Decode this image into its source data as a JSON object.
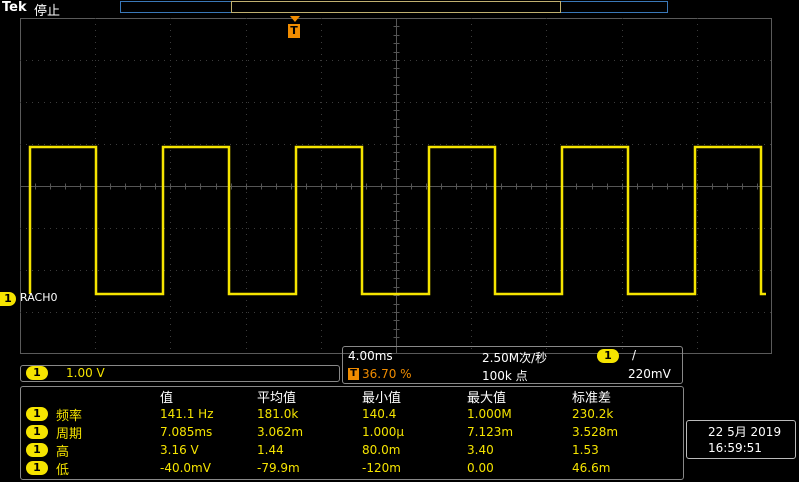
{
  "header": {
    "brand": "Tek",
    "status": "停止"
  },
  "trigger": {
    "marker": "T"
  },
  "channel": {
    "id": "1",
    "name": "RACH0",
    "scale": "1.00 V"
  },
  "timebase": {
    "horizontal_scale": "4.00ms",
    "sample_rate": "2.50M次/秒",
    "trigger_position": "36.70 %",
    "record_length": "100k 点",
    "trigger_channel": "1",
    "trigger_slope": "/",
    "trigger_level": "220mV"
  },
  "measurements": {
    "headers": [
      "值",
      "平均值",
      "最小值",
      "最大值",
      "标准差"
    ],
    "rows": [
      {
        "label": "频率",
        "value": "141.1 Hz",
        "mean": "181.0k",
        "min": "140.4",
        "max": "1.000M",
        "std": "230.2k"
      },
      {
        "label": "周期",
        "value": "7.085ms",
        "mean": "3.062m",
        "min": "1.000μ",
        "max": "7.123m",
        "std": "3.528m"
      },
      {
        "label": "高",
        "value": "3.16 V",
        "mean": "1.44",
        "min": "80.0m",
        "max": "3.40",
        "std": "1.53"
      },
      {
        "label": "低",
        "value": "-40.0mV",
        "mean": "-79.9m",
        "min": "-120m",
        "max": "0.00",
        "std": "46.6m"
      }
    ]
  },
  "datetime": {
    "date": "22 5月 2019",
    "time": "16:59:51"
  },
  "colors": {
    "trace": "#f5e400",
    "trigger": "#f08c00",
    "grid": "#5a5a5a",
    "border": "#888888"
  }
}
